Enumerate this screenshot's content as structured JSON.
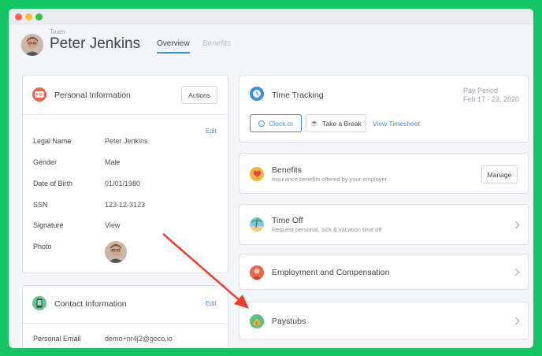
{
  "header": {
    "team_label": "Team",
    "name": "Peter Jenkins",
    "tabs": [
      {
        "label": "Overview",
        "active": true
      },
      {
        "label": "Benefits",
        "active": false
      }
    ]
  },
  "personal_info": {
    "title": "Personal Information",
    "actions_label": "Actions",
    "edit_label": "Edit",
    "rows": [
      {
        "label": "Legal Name",
        "value": "Peter Jenkins"
      },
      {
        "label": "Gender",
        "value": "Male"
      },
      {
        "label": "Date of Birth",
        "value": "01/01/1980"
      },
      {
        "label": "SSN",
        "value": "123-12-3123"
      },
      {
        "label": "Signature",
        "value": "View"
      },
      {
        "label": "Photo",
        "value": ""
      }
    ]
  },
  "contact_info": {
    "title": "Contact Information",
    "edit_label": "Edit",
    "rows": [
      {
        "label": "Personal Email",
        "value": "demo+nr4j2@goco.io"
      }
    ]
  },
  "time_tracking": {
    "title": "Time Tracking",
    "pay_period_label": "Pay Period",
    "pay_period_value": "Feb 17 - 23, 2020",
    "clock_in_label": "Clock In",
    "break_label": "Take a Break",
    "view_timesheet_label": "View Timesheet"
  },
  "benefits": {
    "title": "Benefits",
    "subtitle": "Insurance benefits offered by your employer",
    "manage_label": "Manage"
  },
  "time_off": {
    "title": "Time Off",
    "subtitle": "Request personal, sick & vacation time off"
  },
  "employment": {
    "title": "Employment and Compensation"
  },
  "paystubs": {
    "title": "Paystubs"
  },
  "colors": {
    "background": "#14c463",
    "accent": "#3b8fe0",
    "arrow": "#ec3f2f"
  }
}
